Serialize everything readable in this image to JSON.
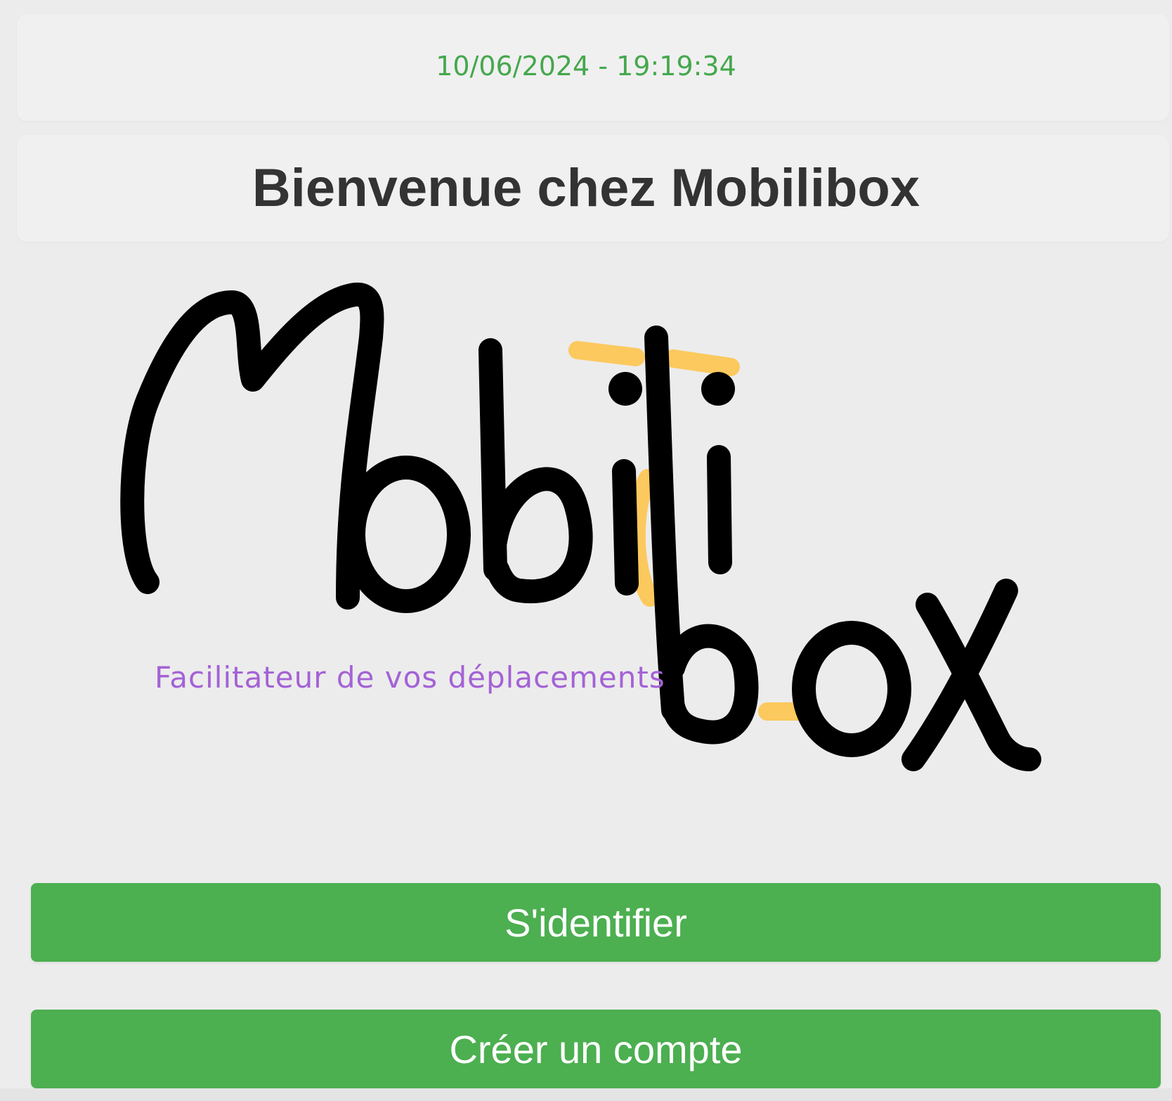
{
  "header": {
    "datetime": "10/06/2024 - 19:19:34"
  },
  "main": {
    "title": "Bienvenue chez Mobilibox"
  },
  "logo": {
    "wordmark": "Mobilibox",
    "tagline": "Facilitateur de vos déplacements",
    "ink_color": "#000000",
    "accent_color": "#fcc95e",
    "tagline_color": "#a462d6"
  },
  "actions": {
    "login_label": "S'identifier",
    "create_account_label": "Créer un compte"
  },
  "colors": {
    "primary_green": "#4caf50",
    "datetime_green": "#45a84d",
    "title_color": "#333333",
    "background": "#ececec",
    "card_background": "#f0f0f0"
  }
}
